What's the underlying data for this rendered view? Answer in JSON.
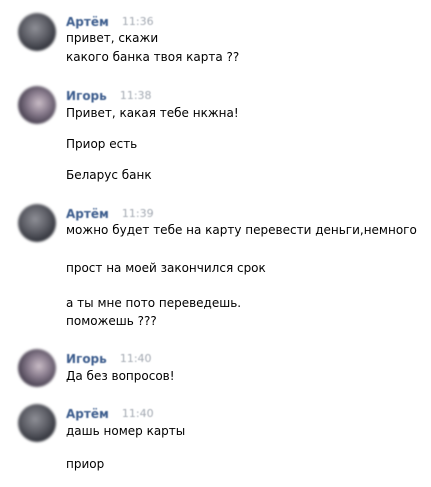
{
  "messages": [
    {
      "author": "Артём",
      "time": "11:36",
      "lines": [
        "привет, скажи",
        "какого банка твоя карта ??"
      ]
    },
    {
      "author": "Игорь",
      "time": "11:38",
      "lines": [
        "Привет, какая тебе нкжна!",
        "Приор есть",
        "Беларус банк"
      ]
    },
    {
      "author": "Артём",
      "time": "11:39",
      "lines": [
        "можно будет тебе на карту перевести деньги,немного",
        "прост на моей закончился срок",
        "а ты мне пото переведешь.",
        "поможешь ???"
      ]
    },
    {
      "author": "Игорь",
      "time": "11:40",
      "lines": [
        "Да без вопросов!"
      ]
    },
    {
      "author": "Артём",
      "time": "11:40",
      "lines": [
        "дашь номер карты",
        "приор"
      ]
    }
  ]
}
